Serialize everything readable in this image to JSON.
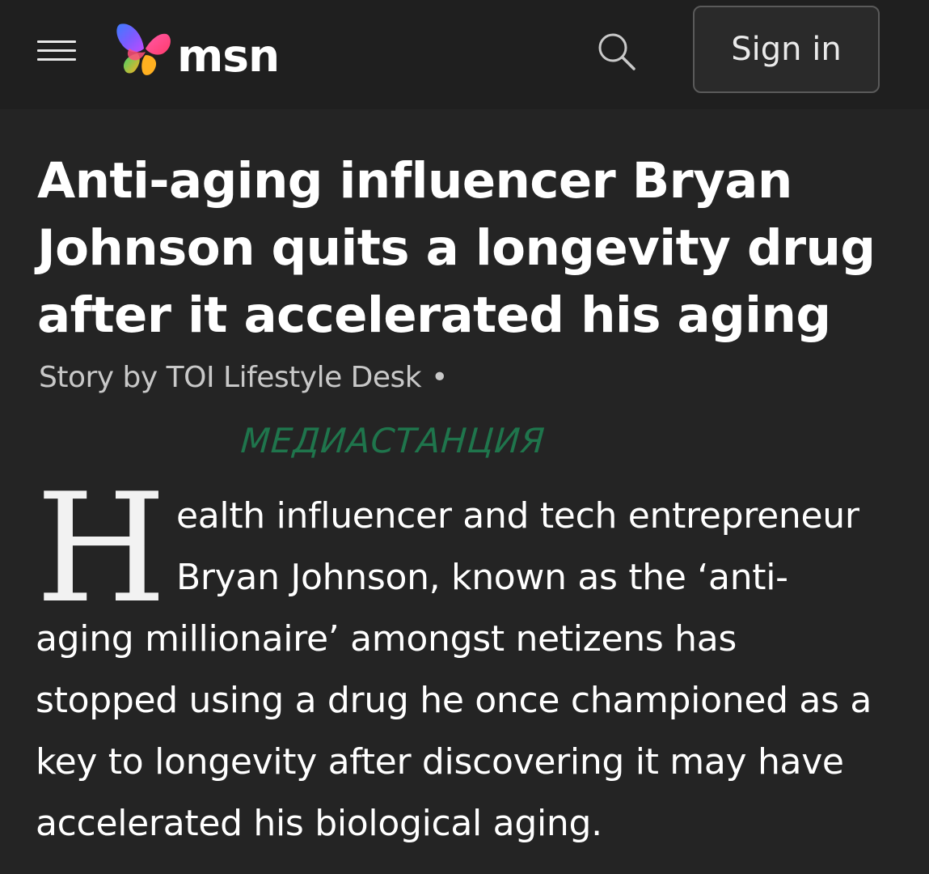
{
  "header": {
    "menu_icon": "hamburger-menu-icon",
    "logo_icon": "msn-butterfly-logo",
    "logo_text": "msn",
    "search_icon": "search-icon",
    "signin_label": "Sign in"
  },
  "article": {
    "headline_lines": [
      "Anti-aging influencer Bryan",
      "Johnson quits a longevity drug",
      "after it accelerated his aging"
    ],
    "byline": "Story by TOI Lifestyle Desk",
    "byline_separator": "•",
    "watermark": "МЕДИАСТАНЦИЯ",
    "drop_cap": "H",
    "body_lines": [
      "ealth influencer and tech entrepreneur",
      "Bryan Johnson, known as the ‘anti-",
      "aging millionaire’ amongst netizens has",
      "stopped using a drug he once championed as a",
      "key to longevity after discovering it may have",
      "accelerated his biological aging."
    ]
  },
  "colors": {
    "background": "#242424",
    "header_background": "#1f1f1f",
    "watermark": "#1f7a4f",
    "byline": "#c8c8c8"
  }
}
